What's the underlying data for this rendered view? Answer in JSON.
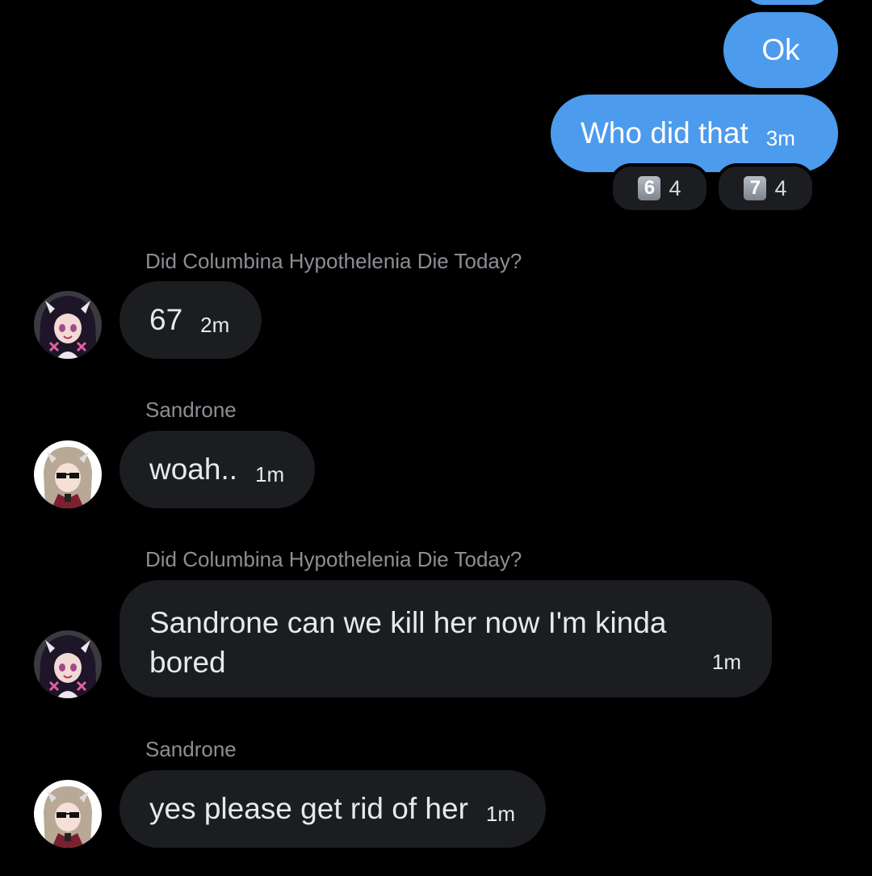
{
  "outgoing": [
    {
      "text": "Ok",
      "time": ""
    },
    {
      "text": "Who did that",
      "time": "3m"
    }
  ],
  "reactions": [
    {
      "emoji": "6",
      "count": "4"
    },
    {
      "emoji": "7",
      "count": "4"
    }
  ],
  "messages": [
    {
      "sender": "Did Columbina Hypothelenia Die Today?",
      "text": "67",
      "time": "2m"
    },
    {
      "sender": "Sandrone",
      "text": "woah..",
      "time": "1m"
    },
    {
      "sender": "Did Columbina Hypothelenia Die Today?",
      "text": "Sandrone can we kill her now I'm kinda bored",
      "time": "1m"
    },
    {
      "sender": "Sandrone",
      "text": "yes please get rid of her",
      "time": "1m"
    }
  ],
  "colors": {
    "outgoing_bubble": "#4c9bec",
    "incoming_bubble": "#1c1d20",
    "background": "#000000"
  }
}
